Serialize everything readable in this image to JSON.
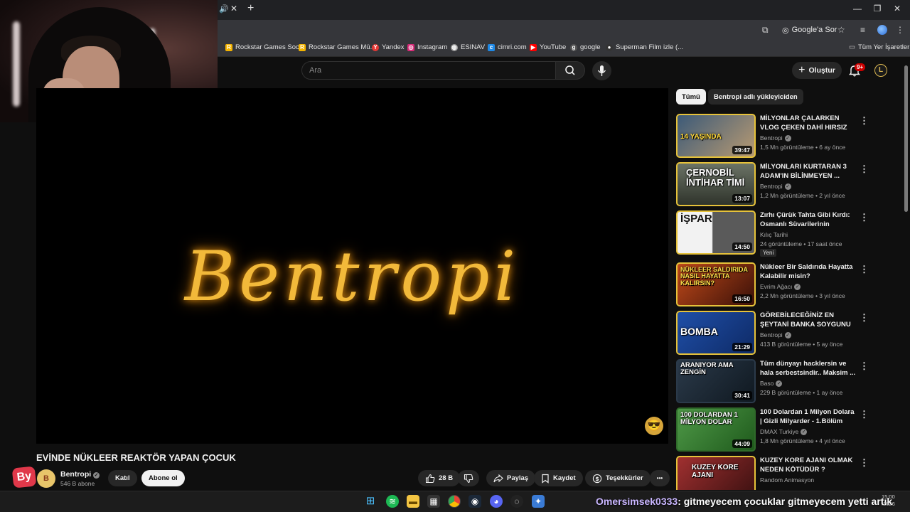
{
  "browser": {
    "bookmarks": [
      {
        "label": "Rockstar Games Soc...",
        "icon": "rockstar-icon",
        "color": "#f4b400"
      },
      {
        "label": "Rockstar Games Mü...",
        "icon": "rockstar-icon",
        "color": "#f4b400"
      },
      {
        "label": "Yandex",
        "icon": "yandex-icon",
        "color": "#e53935"
      },
      {
        "label": "Instagram",
        "icon": "instagram-icon",
        "color": "#d62976"
      },
      {
        "label": "ESINAV",
        "icon": "globe-icon",
        "color": "#9e9e9e"
      },
      {
        "label": "cimri.com",
        "icon": "cimri-icon",
        "color": "#1e88e5"
      },
      {
        "label": "YouTube",
        "icon": "youtube-icon",
        "color": "#ff0000"
      },
      {
        "label": "google",
        "icon": "google-icon",
        "color": "#555555"
      },
      {
        "label": "Superman Film izle (...",
        "icon": "film-icon",
        "color": "#333333"
      }
    ],
    "all_bookmarks_label": "Tüm Yer İşaretleri",
    "lens_label": "Google'a Sor"
  },
  "youtube": {
    "search_placeholder": "Ara",
    "create_label": "Oluştur",
    "notification_count": "9+",
    "account_initial": "L",
    "accent_color": "#ff0000"
  },
  "video": {
    "title": "EVİNDE NÜKLEER REAKTÖR YAPAN ÇOCUK",
    "logo_text": "Bentropi",
    "channel_name": "Bentropi",
    "subscribers": "546 B abone",
    "channel_avatar_text": "B",
    "sticker_text": "By",
    "join_label": "Katıl",
    "subscribe_label": "Abone ol",
    "likes": "28 B",
    "share_label": "Paylaş",
    "save_label": "Kaydet",
    "thanks_label": "Teşekkürler",
    "more_label": "•••"
  },
  "sidebar": {
    "chips": [
      {
        "label": "Tümü",
        "active": true
      },
      {
        "label": "Bentropi adlı yükleyiciden",
        "active": false
      }
    ],
    "recommendations": [
      {
        "title": "MİLYONLAR ÇALARKEN VLOG ÇEKEN DAHİ HIRSIZ",
        "channel": "Bentropi",
        "verified": true,
        "meta": "1,5 Mn görüntüleme • 6 ay önce",
        "duration": "39:47",
        "thumb_text": "14 YAŞINDA",
        "thumb_bg": "#3c5a78"
      },
      {
        "title": "MİLYONLARI KURTARAN 3 ADAM'IN BİLİNMEYEN ...",
        "channel": "Bentropi",
        "verified": true,
        "meta": "1,2 Mn görüntüleme • 2 yıl önce",
        "duration": "13:07",
        "thumb_text": "ÇERNOBİL İNTİHAR TİMİ",
        "thumb_bg": "#4a5248"
      },
      {
        "title": "Zırhı Çürük Tahta Gibi Kırdı: Osmanlı Süvarilerinin Unutula...",
        "channel": "Kılıç Tarihi",
        "verified": false,
        "meta": "24 görüntüleme • 17 saat önce",
        "badge": "Yeni",
        "duration": "14:50",
        "thumb_text": "İŞPAR",
        "thumb_bg": "#e8e8e8"
      },
      {
        "title": "Nükleer Bir Saldırıda Hayatta Kalabilir misin?",
        "channel": "Evrim Ağacı",
        "verified": true,
        "meta": "2,2 Mn görüntüleme • 3 yıl önce",
        "duration": "16:50",
        "thumb_text": "NÜKLEER SALDIRIDA NASIL HAYATTA KALIRSIN?",
        "thumb_bg": "#7a2416"
      },
      {
        "title": "GÖREBİLECEĞİNİZ EN ŞEYTANİ BANKA SOYGUNU",
        "channel": "Bentropi",
        "verified": true,
        "meta": "413 B görüntüleme • 5 ay önce",
        "duration": "21:29",
        "thumb_text": "BOMBA",
        "thumb_bg": "#1f4fa8"
      },
      {
        "title": "Tüm dünyayı hacklersin ve hala serbestsindir.. Maksim ...",
        "channel": "Baso",
        "verified": true,
        "meta": "229 B görüntüleme • 1 ay önce",
        "duration": "30:41",
        "thumb_text": "ARANIYOR AMA ZENGİN",
        "thumb_bg": "#2b3a4a"
      },
      {
        "title": "100 Dolardan 1 Milyon Dolara | Gizli Milyarder - 1.Bölüm",
        "channel": "DMAX Turkiye",
        "verified": true,
        "meta": "1,8 Mn görüntüleme • 4 yıl önce",
        "duration": "44:09",
        "thumb_text": "100 DOLARDAN 1 MİLYON DOLAR",
        "thumb_bg": "#3f8a3a"
      },
      {
        "title": "KUZEY KORE AJANI OLMAK NEDEN KÖTÜDÜR ?",
        "channel": "Random Animasyon",
        "verified": false,
        "meta": "",
        "duration": "",
        "thumb_text": "KUZEY KORE AJANI",
        "thumb_bg": "#8a2a2a"
      }
    ]
  },
  "stream": {
    "chat_user": "Omersimsek0333",
    "chat_message": ": gitmeyecem çocuklar gitmeyecem yetti artık",
    "clock_time": "15:00",
    "clock_date": ".2026"
  }
}
